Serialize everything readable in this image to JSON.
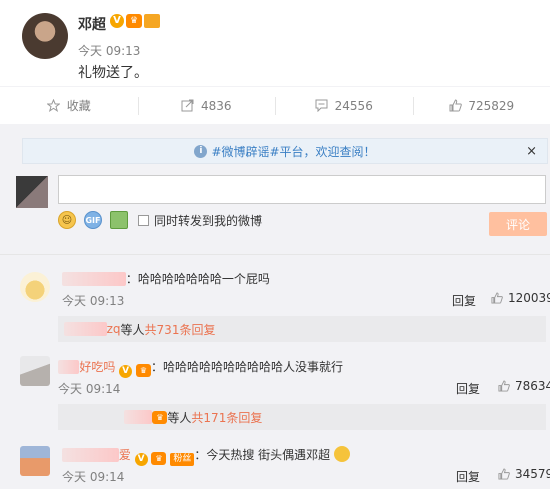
{
  "post": {
    "author": "邓超",
    "verified_badge": "V",
    "time": "今天 09:13",
    "text": "礼物送了。"
  },
  "actions": [
    {
      "icon": "star-icon",
      "label": "收藏"
    },
    {
      "icon": "share-icon",
      "label": "4836"
    },
    {
      "icon": "comment-icon",
      "label": "24556"
    },
    {
      "icon": "thumbs-up-icon",
      "label": "725829"
    }
  ],
  "notice": {
    "text": "#微博辟谣#平台，欢迎查阅！",
    "close": "×"
  },
  "composer": {
    "forward_label": "同时转发到我的微博",
    "submit_label": "评论",
    "gif_label": "GIF"
  },
  "comments": [
    {
      "text": "：哈哈哈哈哈哈哈一个屁吗",
      "time": "今天 09:13",
      "reply_label": "回复",
      "likes": "120039",
      "sub": {
        "suffix": "zq",
        "mid": " 等人 ",
        "count": "共731条回复"
      }
    },
    {
      "name_visible": "好吃吗",
      "text": "：哈哈哈哈哈哈哈哈哈哈人没事就行",
      "time": "今天 09:14",
      "reply_label": "回复",
      "likes": "78634",
      "sub": {
        "mid": " 等人 ",
        "count": "共171条回复"
      }
    },
    {
      "name_visible": "爱",
      "tag": "粉丝",
      "text": "：今天热搜 街头偶遇邓超",
      "time": "今天 09:14",
      "reply_label": "回复",
      "likes": "34579"
    }
  ]
}
